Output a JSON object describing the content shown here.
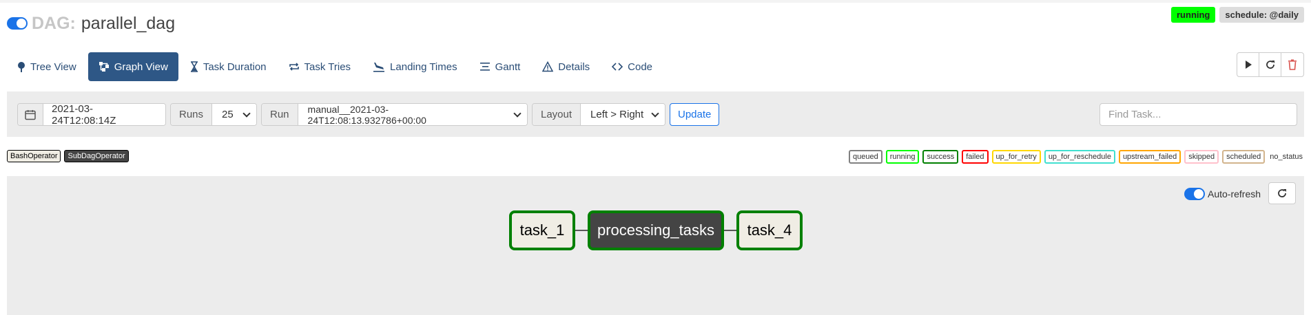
{
  "header": {
    "dag_prefix": "DAG:",
    "dag_name": "parallel_dag",
    "state_badge": "running",
    "schedule_badge": "schedule: @daily"
  },
  "nav": {
    "tabs": [
      {
        "label": "Tree View",
        "icon": "tree-icon"
      },
      {
        "label": "Graph View",
        "icon": "graph-icon",
        "active": true
      },
      {
        "label": "Task Duration",
        "icon": "hourglass-icon"
      },
      {
        "label": "Task Tries",
        "icon": "repeat-icon"
      },
      {
        "label": "Landing Times",
        "icon": "plane-landing-icon"
      },
      {
        "label": "Gantt",
        "icon": "gantt-icon"
      },
      {
        "label": "Details",
        "icon": "warning-triangle-icon"
      },
      {
        "label": "Code",
        "icon": "code-icon"
      }
    ]
  },
  "actions": [
    "play-icon",
    "refresh-icon",
    "trash-icon"
  ],
  "filters": {
    "base_date": "2021-03-24T12:08:14Z",
    "runs_label": "Runs",
    "runs_value": "25",
    "run_label": "Run",
    "run_value": "manual__2021-03-24T12:08:13.932786+00:00",
    "layout_label": "Layout",
    "layout_value": "Left > Right",
    "update_label": "Update",
    "find_placeholder": "Find Task..."
  },
  "operators": [
    {
      "name": "BashOperator",
      "bg": "#f0ede4",
      "color": "#000000"
    },
    {
      "name": "SubDagOperator",
      "bg": "#444444",
      "color": "#ffffff"
    }
  ],
  "states": [
    {
      "name": "queued",
      "color": "#808080"
    },
    {
      "name": "running",
      "color": "#00ff00"
    },
    {
      "name": "success",
      "color": "#008000"
    },
    {
      "name": "failed",
      "color": "#ff0000"
    },
    {
      "name": "up_for_retry",
      "color": "#ffd700"
    },
    {
      "name": "up_for_reschedule",
      "color": "#40e0d0"
    },
    {
      "name": "upstream_failed",
      "color": "#ffa500"
    },
    {
      "name": "skipped",
      "color": "#ffc0cb"
    },
    {
      "name": "scheduled",
      "color": "#d2b48c"
    },
    {
      "name": "no_status",
      "color": ""
    }
  ],
  "graph": {
    "autorefresh_label": "Auto-refresh",
    "nodes": [
      {
        "label": "task_1",
        "operator": "BashOperator",
        "state": "success"
      },
      {
        "label": "processing_tasks",
        "operator": "SubDagOperator",
        "state": "success"
      },
      {
        "label": "task_4",
        "operator": "BashOperator",
        "state": "success"
      }
    ]
  }
}
